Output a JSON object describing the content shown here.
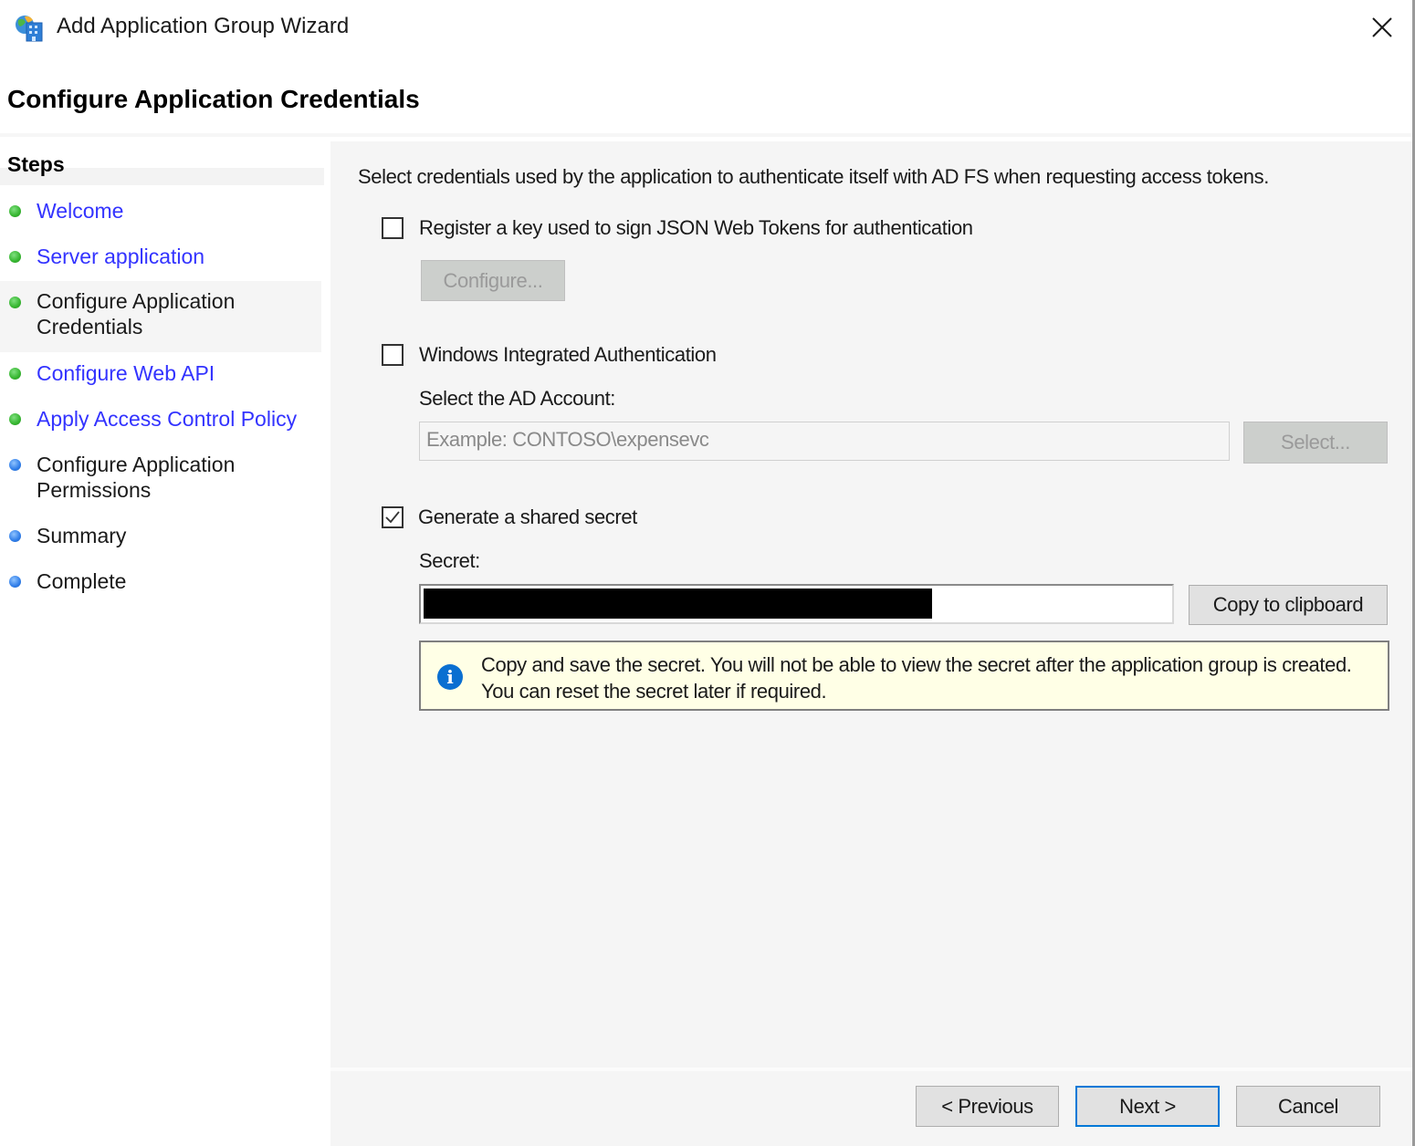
{
  "window": {
    "title": "Add Application Group Wizard",
    "icon": "application-group-wizard-icon",
    "close_icon": "close-icon"
  },
  "page": {
    "title": "Configure Application Credentials"
  },
  "steps": {
    "title": "Steps",
    "items": [
      {
        "label": "Welcome",
        "status": "completed",
        "dot_color": "#35b52f",
        "link": true,
        "active": false
      },
      {
        "label": "Server application",
        "status": "completed",
        "dot_color": "#35b52f",
        "link": true,
        "active": false
      },
      {
        "label": "Configure Application Credentials",
        "status": "current",
        "dot_color": "#35b52f",
        "link": false,
        "active": true
      },
      {
        "label": "Configure Web API",
        "status": "completed",
        "dot_color": "#35b52f",
        "link": true,
        "active": false
      },
      {
        "label": "Apply Access Control Policy",
        "status": "completed",
        "dot_color": "#35b52f",
        "link": true,
        "active": false
      },
      {
        "label": "Configure Application Permissions",
        "status": "pending",
        "dot_color": "#2f7de8",
        "link": false,
        "active": false
      },
      {
        "label": "Summary",
        "status": "pending",
        "dot_color": "#2f7de8",
        "link": false,
        "active": false
      },
      {
        "label": "Complete",
        "status": "pending",
        "dot_color": "#2f7de8",
        "link": false,
        "active": false
      }
    ]
  },
  "main": {
    "intro": "Select credentials used by the application to authenticate itself with AD FS when requesting access tokens.",
    "jwt": {
      "label": "Register a key used to sign JSON Web Tokens for authentication",
      "checked": false,
      "configure_button": "Configure...",
      "configure_enabled": false
    },
    "wia": {
      "label": "Windows Integrated Authentication",
      "checked": false,
      "account_label": "Select the AD Account:",
      "account_placeholder": "Example: CONTOSO\\expensevc",
      "account_value": "",
      "select_button": "Select...",
      "select_enabled": false
    },
    "shared_secret": {
      "label": "Generate a shared secret",
      "checked": true,
      "secret_label": "Secret:",
      "secret_value": "[redacted]",
      "copy_button": "Copy to clipboard",
      "info_icon": "info-icon",
      "info_text": "Copy and save the secret.  You will not be able to view the secret after the application group is created.  You can reset the secret later if required."
    }
  },
  "footer": {
    "previous": "< Previous",
    "next": "Next >",
    "cancel": "Cancel"
  },
  "colors": {
    "link": "#3333ff",
    "completed_dot": "#35b52f",
    "pending_dot": "#2f7de8",
    "info_background": "#ffffe6",
    "default_button_border": "#0078d7"
  }
}
